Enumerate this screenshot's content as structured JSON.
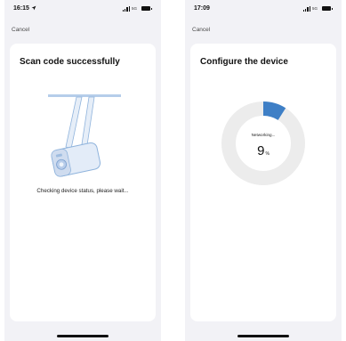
{
  "screens": [
    {
      "status": {
        "time": "16:15",
        "network": "5G"
      },
      "nav": {
        "cancel_label": "Cancel"
      },
      "title": "Scan code successfully",
      "message": "Checking device status, please wait..."
    },
    {
      "status": {
        "time": "17:09",
        "network": "5G"
      },
      "nav": {
        "cancel_label": "Cancel"
      },
      "title": "Configure the device",
      "progress": {
        "label": "Networking...",
        "value": "9",
        "unit": "%",
        "fraction": 0.09
      }
    }
  ],
  "colors": {
    "accent": "#3e7fc6",
    "track": "#ececec",
    "card": "#ffffff",
    "background": "#f2f2f6"
  },
  "icons": [
    "location-arrow-icon",
    "signal-icon",
    "battery-icon",
    "camera-illustration"
  ]
}
